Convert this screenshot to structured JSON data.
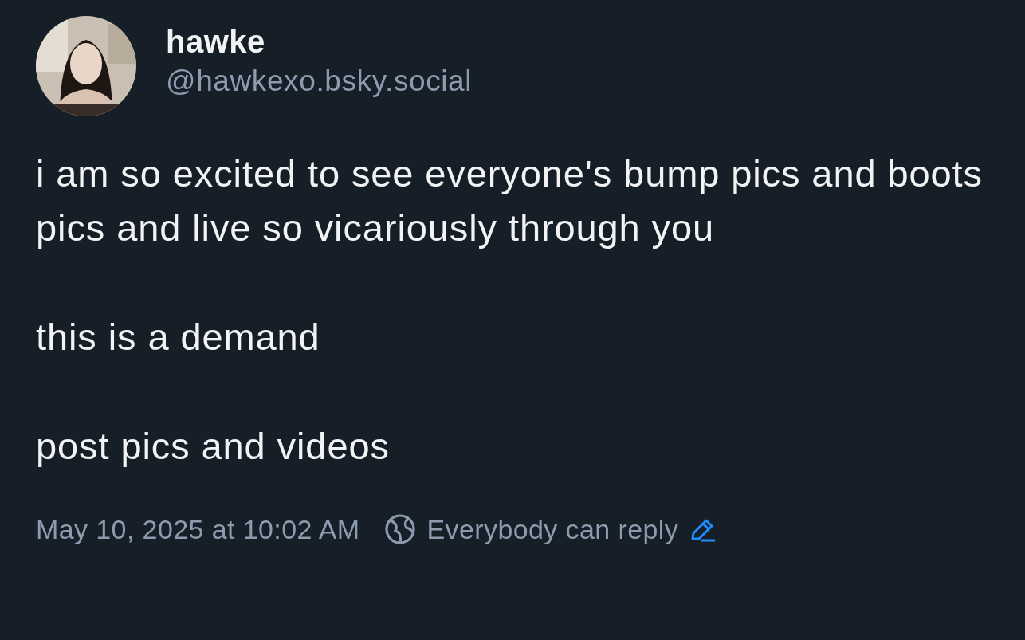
{
  "author": {
    "display_name": "hawke",
    "handle": "@hawkexo.bsky.social"
  },
  "post": {
    "paragraphs": [
      "i am so excited to see everyone's bump pics and boots pics and live so vicariously through you",
      "this is a demand",
      "post pics and videos"
    ]
  },
  "footer": {
    "timestamp": "May 10, 2025 at 10:02 AM",
    "reply_setting": "Everybody can reply",
    "editable": true
  }
}
